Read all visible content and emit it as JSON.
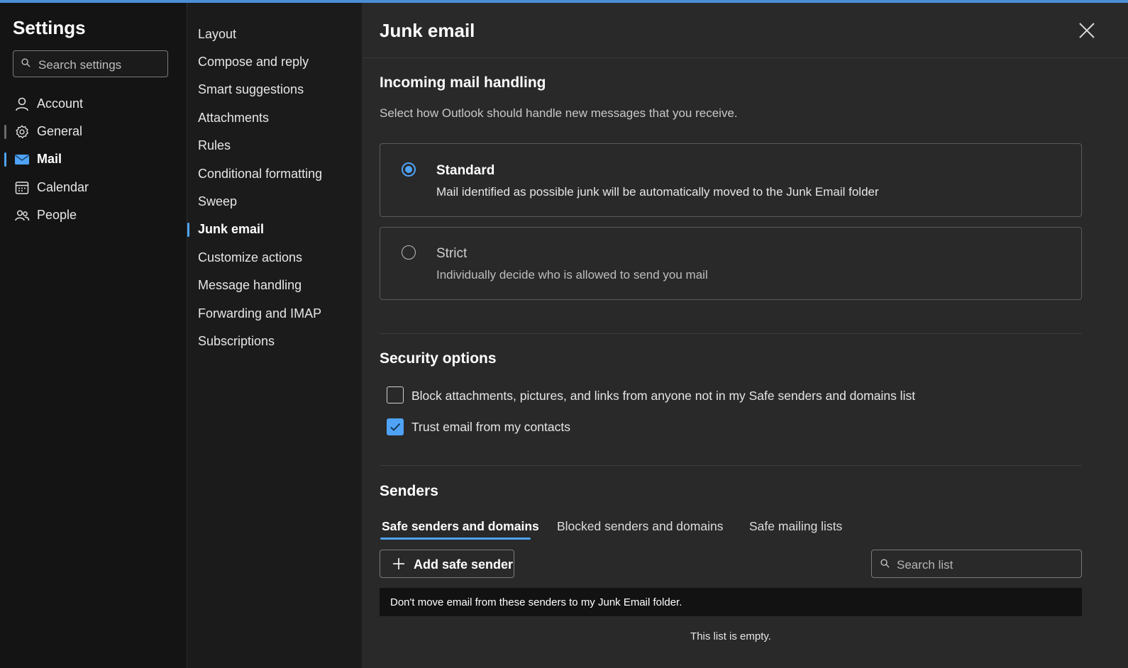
{
  "app": {
    "title": "Settings",
    "search_placeholder": "Search settings",
    "accent_color": "#4fa3f7"
  },
  "nav": {
    "items": [
      {
        "label": "Account",
        "icon": "person-icon"
      },
      {
        "label": "General",
        "icon": "gear-icon"
      },
      {
        "label": "Mail",
        "icon": "mail-icon"
      },
      {
        "label": "Calendar",
        "icon": "calendar-icon"
      },
      {
        "label": "People",
        "icon": "people-icon"
      }
    ],
    "selected": "Mail"
  },
  "subnav": {
    "items": [
      "Layout",
      "Compose and reply",
      "Smart suggestions",
      "Attachments",
      "Rules",
      "Conditional formatting",
      "Sweep",
      "Junk email",
      "Customize actions",
      "Message handling",
      "Forwarding and IMAP",
      "Subscriptions"
    ],
    "selected": "Junk email"
  },
  "panel": {
    "title": "Junk email",
    "incoming": {
      "heading": "Incoming mail handling",
      "description": "Select how Outlook should handle new messages that you receive.",
      "options": [
        {
          "title": "Standard",
          "description": "Mail identified as possible junk will be automatically moved to the Junk Email folder",
          "selected": true
        },
        {
          "title": "Strict",
          "description": "Individually decide who is allowed to send you mail",
          "selected": false
        }
      ]
    },
    "security": {
      "heading": "Security options",
      "checkboxes": [
        {
          "label": "Block attachments, pictures, and links from anyone not in my Safe senders and domains list",
          "checked": false
        },
        {
          "label": "Trust email from my contacts",
          "checked": true
        }
      ]
    },
    "senders": {
      "heading": "Senders",
      "tabs": [
        "Safe senders and domains",
        "Blocked senders and domains",
        "Safe mailing lists"
      ],
      "active_tab": "Safe senders and domains",
      "add_button": "Add safe sender",
      "search_placeholder": "Search list",
      "list_header": "Don't move email from these senders to my Junk Email folder.",
      "empty_text": "This list is empty."
    }
  }
}
